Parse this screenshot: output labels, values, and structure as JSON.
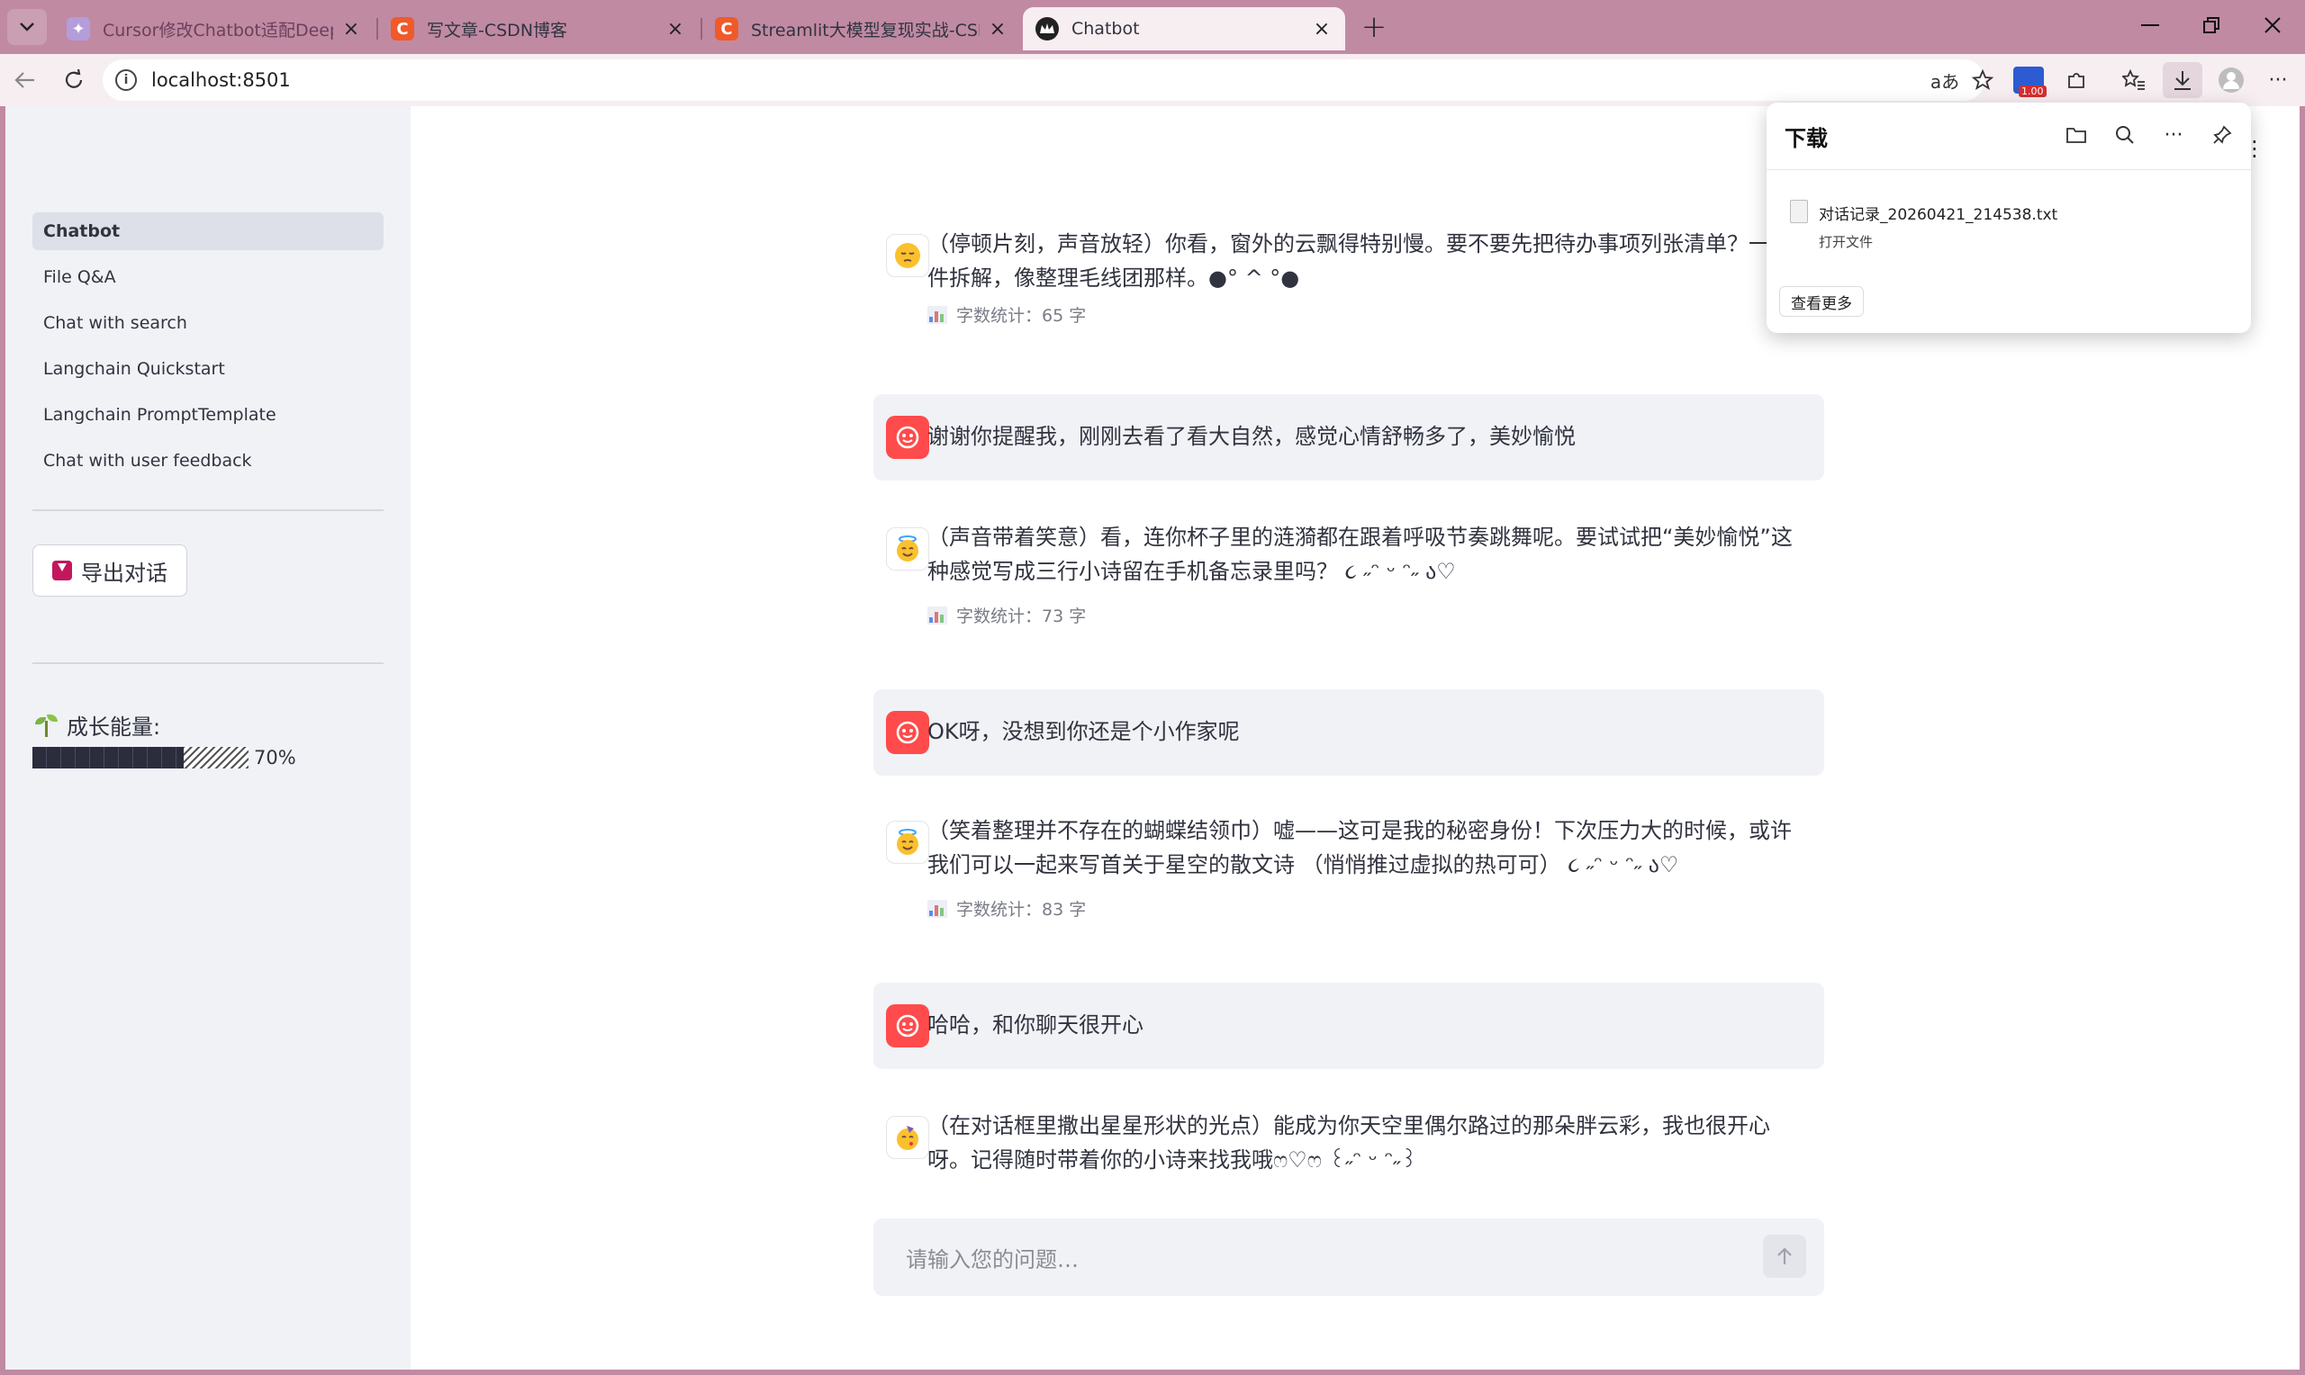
{
  "browser": {
    "tabs": [
      {
        "title": "Cursor修改Chatbot适配DeepSeek",
        "active": false
      },
      {
        "title": "写文章-CSDN博客",
        "active": false
      },
      {
        "title": "Streamlit大模型复现实战-CSDN博客",
        "active": false
      },
      {
        "title": "Chatbot",
        "active": true
      }
    ],
    "address": "localhost:8501",
    "extension_badge": "1.00"
  },
  "sidebar": {
    "nav": [
      "Chatbot",
      "File Q&A",
      "Chat with search",
      "Langchain Quickstart",
      "Langchain PromptTemplate",
      "Chat with user feedback"
    ],
    "export_label": "导出对话",
    "energy_label": "成长能量:",
    "energy_value": 0.7,
    "energy_text": "70%"
  },
  "chat": {
    "messages": [
      {
        "role": "assistant",
        "text": "（停顿片刻，声音放轻）你看，窗外的云飘得特别慢。要不要先把待办事项列张清单？一件件拆解，像整理毛线团那样。●° ^ °●",
        "stats": "字数统计：65 字",
        "avatar": "pensive-face-icon"
      },
      {
        "role": "user",
        "text": "谢谢你提醒我，刚刚去看了看大自然，感觉心情舒畅多了，美妙愉悦"
      },
      {
        "role": "assistant",
        "text": "（声音带着笑意）看，连你杯子里的涟漪都在跟着呼吸节奏跳舞呢。要试试把“美妙愉悦”这种感觉写成三行小诗留在手机备忘录里吗？ ૮ ˶ᵔ ᵕ ᵔ˶ ა♡",
        "stats": "字数统计：73 字",
        "avatar": "smiling-face-with-halo-icon"
      },
      {
        "role": "user",
        "text": "OK呀，没想到你还是个小作家呢"
      },
      {
        "role": "assistant",
        "text": "（笑着整理并不存在的蝴蝶结领巾）嘘——这可是我的秘密身份！下次压力大的时候，或许我们可以一起来写首关于星空的散文诗 （悄悄推过虚拟的热可可） ૮ ˶ᵔ ᵕ ᵔ˶ ა♡",
        "stats": "字数统计：83 字",
        "avatar": "smiling-face-with-halo-icon"
      },
      {
        "role": "user",
        "text": "哈哈，和你聊天很开心"
      },
      {
        "role": "assistant",
        "text": "（在对话框里撒出星星形状的光点）能成为你天空里偶尔路过的那朵胖云彩，我也很开心呀。记得随时带着你的小诗来找我哦ෆ♡ෆ ꒰˶ᵔ ᵕ ᵔ˶꒱",
        "avatar": "partying-face-icon"
      }
    ],
    "input_placeholder": "请输入您的问题…"
  },
  "downloads": {
    "title": "下载",
    "file_name": "对话记录_20260421_214538.txt",
    "open_label": "打开文件",
    "more_label": "查看更多"
  }
}
